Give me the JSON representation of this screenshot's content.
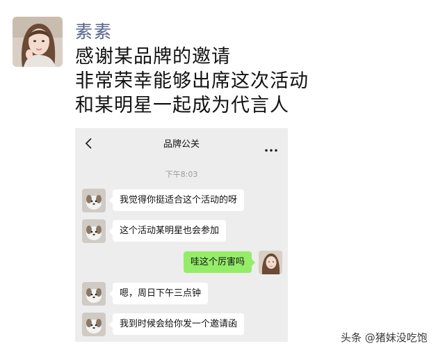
{
  "post": {
    "poster_name": "素素",
    "lines": [
      "感谢某品牌的邀请",
      "非常荣幸能够出席这次活动",
      "和某明星一起成为代言人"
    ]
  },
  "chat": {
    "title": "品牌公关",
    "back_icon": "chevron-left-icon",
    "more_icon": "more-dots-icon",
    "timestamp": "下午8:03",
    "messages": [
      {
        "from": "contact",
        "text": "我觉得你挺适合这个活动的呀"
      },
      {
        "from": "contact",
        "text": "这个活动某明星也会参加"
      },
      {
        "from": "self",
        "text": "哇这个厉害吗"
      },
      {
        "from": "contact",
        "text": "嗯，周日下午三点钟"
      },
      {
        "from": "contact",
        "text": "我到时候会给你发一个邀请函"
      }
    ],
    "colors": {
      "background": "#ededed",
      "sent_bubble": "#95ec69",
      "received_bubble": "#ffffff"
    }
  },
  "watermark": "头条 @猪妹没吃饱",
  "colors": {
    "poster_name": "#57648c"
  }
}
